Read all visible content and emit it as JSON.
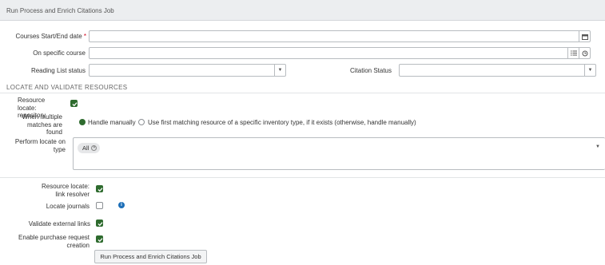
{
  "header": {
    "title": "Run Process and Enrich Citations Job"
  },
  "form": {
    "courses_date_label": "Courses Start/End date",
    "required_mark": "*",
    "specific_course_label": "On specific course",
    "reading_list_status_label": "Reading List status",
    "citation_status_label": "Citation Status"
  },
  "section": {
    "title": "LOCATE AND VALIDATE RESOURCES"
  },
  "resources": {
    "repository_label": "Resource locate: repository",
    "repository_checked": true,
    "multiple_matches_label": "When multiple matches are found",
    "option_handle_manually": "Handle manually",
    "option_first_matching": "Use first matching resource of a specific inventory type, if it exists (otherwise, handle manually)",
    "selected_option": "Handle manually",
    "perform_locate_label": "Perform locate on type",
    "perform_locate_chips": [
      "All"
    ],
    "link_resolver_label": "Resource locate: link resolver",
    "link_resolver_checked": true,
    "locate_journals_label": "Locate journals",
    "locate_journals_checked": false,
    "validate_links_label": "Validate external links",
    "validate_links_checked": true,
    "purchase_request_label": "Enable purchase request creation",
    "purchase_request_checked": true
  },
  "actions": {
    "run_button": "Run Process and Enrich Citations Job"
  },
  "colors": {
    "accent": "#2e6b2e",
    "info": "#1d6fb8",
    "required": "#d0021b"
  }
}
